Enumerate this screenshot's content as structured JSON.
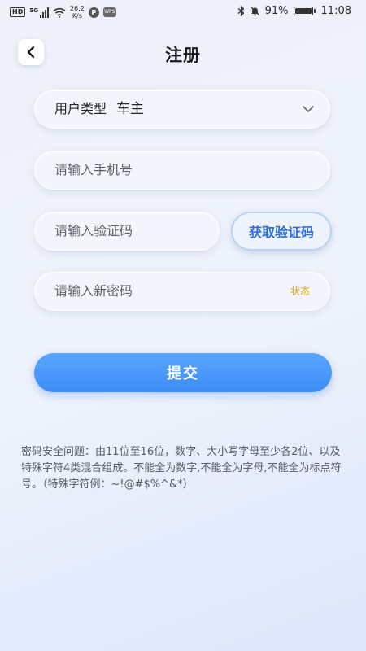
{
  "status_bar": {
    "hd": "HD",
    "signal": "5G",
    "net_speed_value": "26.2",
    "net_speed_unit": "K/s",
    "app_badge_1": "P",
    "app_badge_2": "WPS",
    "battery_percent": "91%",
    "time": "11:08"
  },
  "header": {
    "title": "注册"
  },
  "form": {
    "user_type_label": "用户类型",
    "user_type_value": "车主",
    "phone_placeholder": "请输入手机号",
    "code_placeholder": "请输入验证码",
    "get_code_label": "获取验证码",
    "password_placeholder": "请输入新密码",
    "password_toggle_label": "状态",
    "submit_label": "提交"
  },
  "notice": {
    "text": "密码安全问题：由11位至16位，数字、大小写字母至少各2位、以及特殊字符4类混合组成。不能全为数字,不能全为字母,不能全为标点符号。（特殊字符例：~!@#$%^&*）"
  },
  "colors": {
    "accent": "#3d8cf5",
    "link": "#2d6fd8",
    "status_label": "#e0a516"
  }
}
